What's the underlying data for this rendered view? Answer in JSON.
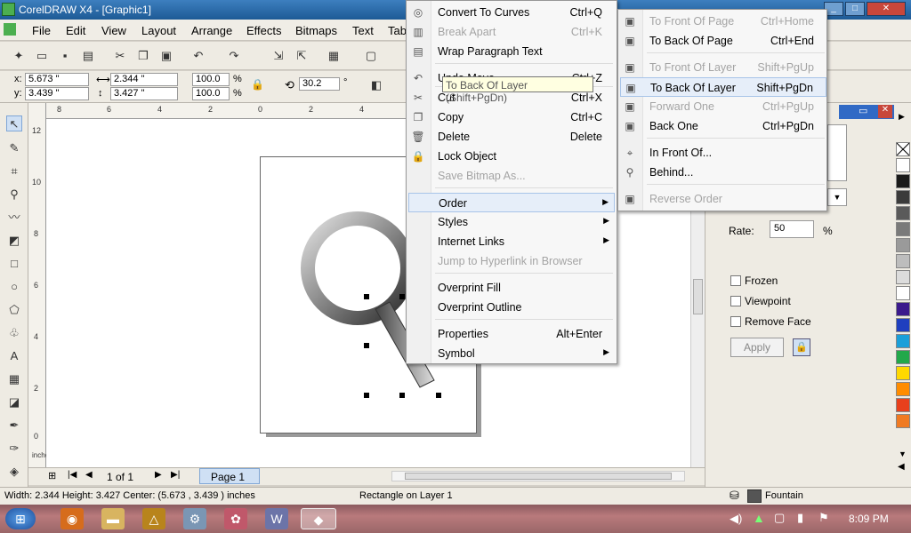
{
  "window": {
    "title": "CorelDRAW X4 - [Graphic1]"
  },
  "menus": [
    "File",
    "Edit",
    "View",
    "Layout",
    "Arrange",
    "Effects",
    "Bitmaps",
    "Text",
    "Tab"
  ],
  "propbar": {
    "x": "5.673 \"",
    "y": "3.439 \"",
    "w": "2.344 \"",
    "h": "3.427 \"",
    "scale_x": "100.0",
    "scale_y": "100.0",
    "pct": "%",
    "angle": "30.2",
    "deg": "°",
    "x_lbl": "x:",
    "y_lbl": "y:"
  },
  "ruler": {
    "h_ticks": [
      "8",
      "6",
      "4",
      "2",
      "0",
      "2",
      "4"
    ],
    "v_ticks": [
      "12",
      "10",
      "8",
      "6",
      "4",
      "2",
      "0"
    ],
    "unit": "inches"
  },
  "pagebar": {
    "page_count": "1 of 1",
    "page_tab": "Page 1"
  },
  "context_menu": [
    {
      "label": "Convert To Curves",
      "shortcut": "Ctrl+Q",
      "icon": "curve-icon",
      "enabled": true
    },
    {
      "label": "Break Apart",
      "shortcut": "Ctrl+K",
      "icon": "break-apart-icon",
      "enabled": false
    },
    {
      "label": "Wrap Paragraph Text",
      "shortcut": "",
      "icon": "wrap-text-icon",
      "enabled": true
    },
    {
      "label": "Undo Move",
      "shortcut": "Ctrl+Z",
      "icon": "undo-icon",
      "enabled": true
    },
    {
      "label": "Cut",
      "shortcut": "Ctrl+X",
      "icon": "scissors-icon",
      "enabled": true
    },
    {
      "label": "Copy",
      "shortcut": "Ctrl+C",
      "icon": "copy-icon",
      "enabled": true
    },
    {
      "label": "Delete",
      "shortcut": "Delete",
      "icon": "trash-icon",
      "enabled": true
    },
    {
      "label": "Lock Object",
      "shortcut": "",
      "icon": "lock-icon",
      "enabled": true
    },
    {
      "label": "Save Bitmap As...",
      "shortcut": "",
      "icon": "",
      "enabled": false
    },
    {
      "label": "Order",
      "shortcut": "",
      "icon": "",
      "enabled": true
    },
    {
      "label": "Styles",
      "shortcut": "",
      "icon": "",
      "enabled": true
    },
    {
      "label": "Internet Links",
      "shortcut": "",
      "icon": "",
      "enabled": true
    },
    {
      "label": "Jump to Hyperlink in Browser",
      "shortcut": "",
      "icon": "",
      "enabled": false
    },
    {
      "label": "Overprint Fill",
      "shortcut": "",
      "icon": "",
      "enabled": true
    },
    {
      "label": "Overprint Outline",
      "shortcut": "",
      "icon": "",
      "enabled": true
    },
    {
      "label": "Properties",
      "shortcut": "Alt+Enter",
      "icon": "",
      "enabled": true
    },
    {
      "label": "Symbol",
      "shortcut": "",
      "icon": "",
      "enabled": true
    }
  ],
  "order_submenu": [
    {
      "label": "To Front Of Page",
      "shortcut": "Ctrl+Home",
      "enabled": false
    },
    {
      "label": "To Back Of Page",
      "shortcut": "Ctrl+End",
      "enabled": true
    },
    {
      "label": "To Front Of Layer",
      "shortcut": "Shift+PgUp",
      "enabled": false
    },
    {
      "label": "To Back Of Layer",
      "shortcut": "Shift+PgDn",
      "enabled": true
    },
    {
      "label": "Forward One",
      "shortcut": "Ctrl+PgUp",
      "enabled": false
    },
    {
      "label": "Back One",
      "shortcut": "Ctrl+PgDn",
      "enabled": true
    },
    {
      "label": "In Front Of...",
      "shortcut": "",
      "enabled": true
    },
    {
      "label": "Behind...",
      "shortcut": "",
      "enabled": true
    },
    {
      "label": "Reverse Order",
      "shortcut": "",
      "enabled": false
    }
  ],
  "tooltip": "To Back Of Layer (Shift+PgDn)",
  "docker": {
    "rate_label": "Rate:",
    "rate_value": "50",
    "rate_unit": "%",
    "frozen": "Frozen",
    "viewpoint": "Viewpoint",
    "remove_face": "Remove Face",
    "apply": "Apply"
  },
  "status": {
    "dims": "Width: 2.344  Height: 3.427  Center: (5.673 , 3.439 )  inches",
    "object": "Rectangle on Layer 1",
    "fill": "Fountain"
  },
  "clock": "8:09 PM",
  "palette_colors": [
    "#ffffff",
    "#1a1a1a",
    "#3b3b3b",
    "#5a5a5a",
    "#7a7a7a",
    "#9a9a9a",
    "#bdbdbd",
    "#dcdcdc",
    "#ffffff",
    "#3b1a8c",
    "#1f3fbf",
    "#1a9fd9",
    "#22a84a",
    "#ffd800",
    "#ff8c00",
    "#e8401c",
    "#f07a22"
  ],
  "accent": "#316ac5"
}
